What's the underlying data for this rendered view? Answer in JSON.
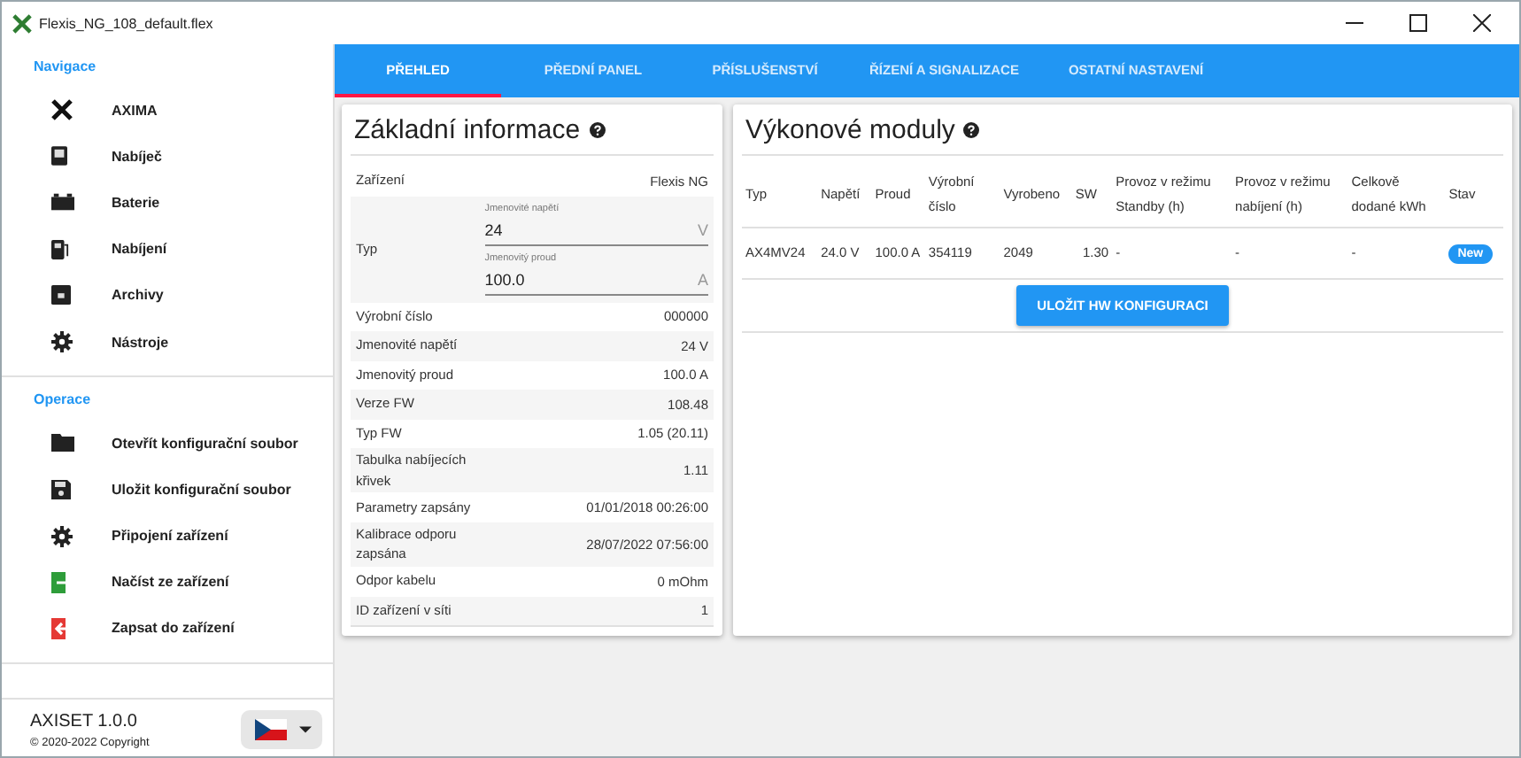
{
  "window": {
    "title": "Flexis_NG_108_default.flex"
  },
  "sidebar": {
    "sections": [
      {
        "title": "Navigace",
        "items": [
          {
            "label": "AXIMA"
          },
          {
            "label": "Nabíječ"
          },
          {
            "label": "Baterie"
          },
          {
            "label": "Nabíjení"
          },
          {
            "label": "Archivy"
          },
          {
            "label": "Nástroje"
          }
        ]
      },
      {
        "title": "Operace",
        "items": [
          {
            "label": "Otevřít konfigurační soubor"
          },
          {
            "label": "Uložit konfigurační soubor"
          },
          {
            "label": "Připojení zařízení"
          },
          {
            "label": "Načíst ze zařízení"
          },
          {
            "label": "Zapsat do zařízení"
          }
        ]
      }
    ],
    "app_name": "AXISET 1.0.0",
    "copyright": "© 2020-2022 Copyright"
  },
  "tabs": [
    {
      "label": "PŘEHLED",
      "selected": true
    },
    {
      "label": "PŘEDNÍ PANEL",
      "selected": false
    },
    {
      "label": "PŘÍSLUŠENSTVÍ",
      "selected": false
    },
    {
      "label": "ŘÍZENÍ A SIGNALIZACE",
      "selected": false
    },
    {
      "label": "OSTATNÍ NASTAVENÍ",
      "selected": false
    }
  ],
  "basic_info": {
    "title": "Základní informace",
    "rows": [
      {
        "kind": "text",
        "label": "Zařízení",
        "value": "Flexis NG"
      },
      {
        "kind": "fields",
        "label": "Typ",
        "fields": [
          {
            "label": "Jmenovité napětí",
            "value": "24",
            "suffix": "V"
          },
          {
            "label": "Jmenovitý proud",
            "value": "100.0",
            "suffix": "A"
          }
        ]
      },
      {
        "kind": "text",
        "label": "Výrobní číslo",
        "value": "000000"
      },
      {
        "kind": "text",
        "label": "Jmenovité napětí",
        "value": "24 V"
      },
      {
        "kind": "text",
        "label": "Jmenovitý proud",
        "value": "100.0 A"
      },
      {
        "kind": "text",
        "label": "Verze FW",
        "value": "108.48"
      },
      {
        "kind": "text",
        "label": "Typ FW",
        "value": "1.05 (20.11)"
      },
      {
        "kind": "text",
        "label": "Tabulka nabíjecích křivek",
        "value": "1.11"
      },
      {
        "kind": "text",
        "label": "Parametry zapsány",
        "value": "01/01/2018 00:26:00"
      },
      {
        "kind": "text",
        "label": "Kalibrace odporu zapsána",
        "value": "28/07/2022 07:56:00"
      },
      {
        "kind": "text",
        "label": "Odpor kabelu",
        "value": "0 mOhm"
      },
      {
        "kind": "text",
        "label": "ID zařízení v síti",
        "value": "1"
      }
    ]
  },
  "power_modules": {
    "title": "Výkonové moduly",
    "columns": [
      "Typ",
      "Napětí",
      "Proud",
      "Výrobní číslo",
      "Vyrobeno",
      "SW",
      "Provoz v režimu Standby (h)",
      "Provoz v režimu nabíjení (h)",
      "Celkově dodané kWh",
      "Stav"
    ],
    "rows": [
      {
        "cells": [
          "AX4MV24",
          "24.0 V",
          "100.0 A",
          "354119",
          "2049",
          "1.30",
          "-",
          "-",
          "-"
        ],
        "status": "New"
      }
    ],
    "save_button": "ULOŽIT HW KONFIGURACI"
  }
}
